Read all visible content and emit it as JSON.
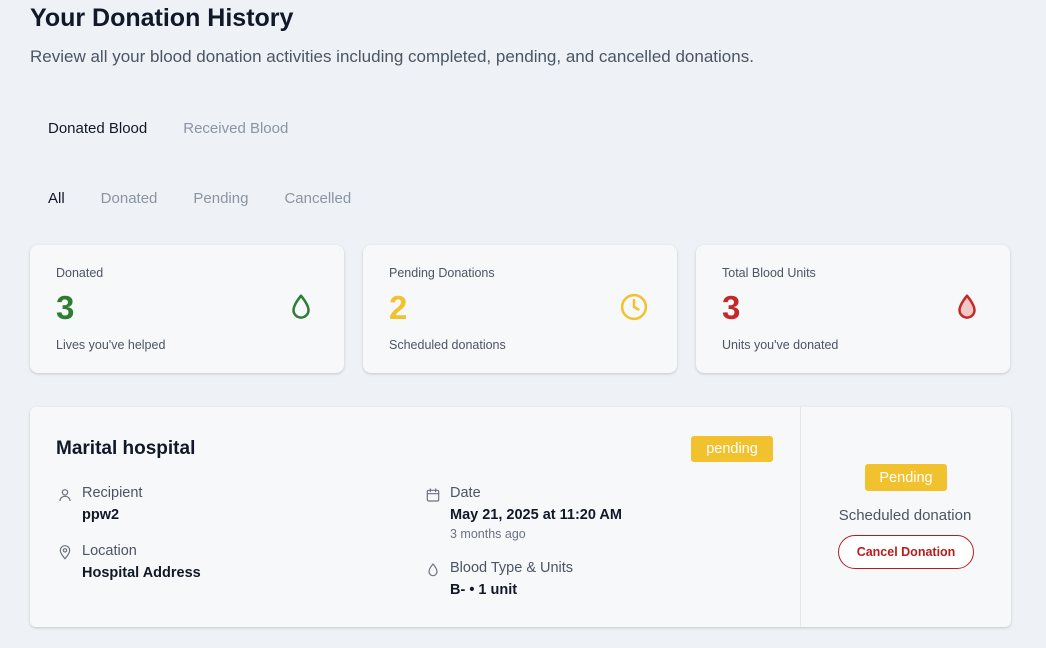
{
  "header": {
    "title": "Your Donation History",
    "subtitle": "Review all your blood donation activities including completed, pending, and cancelled donations."
  },
  "main_tabs": [
    {
      "label": "Donated Blood",
      "active": true
    },
    {
      "label": "Received Blood",
      "active": false
    }
  ],
  "filter_tabs": [
    {
      "label": "All",
      "active": true
    },
    {
      "label": "Donated",
      "active": false
    },
    {
      "label": "Pending",
      "active": false
    },
    {
      "label": "Cancelled",
      "active": false
    }
  ],
  "stats": [
    {
      "label": "Donated",
      "value": "3",
      "caption": "Lives you've helped",
      "icon": "blood-drop-outline-icon",
      "color": "#2e7d32"
    },
    {
      "label": "Pending Donations",
      "value": "2",
      "caption": "Scheduled donations",
      "icon": "clock-icon",
      "color": "#f2c12e"
    },
    {
      "label": "Total Blood Units",
      "value": "3",
      "caption": "Units you've donated",
      "icon": "blood-drop-filled-icon",
      "color": "#c62828"
    }
  ],
  "donation": {
    "hospital": "Marital hospital",
    "status": "pending",
    "recipient_label": "Recipient",
    "recipient": "ppw2",
    "location_label": "Location",
    "location": "Hospital Address",
    "date_label": "Date",
    "date": "May 21, 2025 at 11:20 AM",
    "date_relative": "3 months ago",
    "blood_label": "Blood Type & Units",
    "blood": "B- • 1 unit",
    "side_status": "Pending",
    "side_caption": "Scheduled donation",
    "cancel_label": "Cancel Donation"
  },
  "colors": {
    "accent_yellow": "#f2c12e",
    "danger_red": "#b91c1c",
    "success_green": "#2e7d32"
  }
}
